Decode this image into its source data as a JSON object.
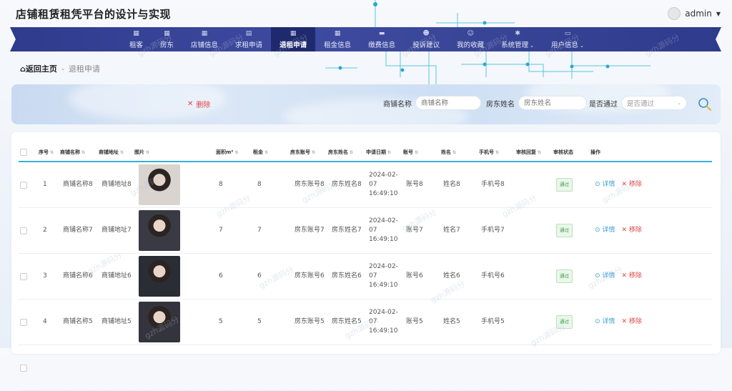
{
  "app": {
    "title": "店铺租赁租凭平台的设计与实现",
    "user": "admin"
  },
  "nav": {
    "items": [
      {
        "label": "租客",
        "icon": "grid-icon"
      },
      {
        "label": "房东",
        "icon": "grid-icon"
      },
      {
        "label": "店铺信息",
        "icon": "grid-icon"
      },
      {
        "label": "求租申请",
        "icon": "clipboard-icon"
      },
      {
        "label": "退租申请",
        "icon": "grid-icon",
        "active": true
      },
      {
        "label": "租金信息",
        "icon": "grid-icon"
      },
      {
        "label": "缴费信息",
        "icon": "chat-icon"
      },
      {
        "label": "投诉建议",
        "icon": "users-icon"
      },
      {
        "label": "我的收藏",
        "icon": "user-icon"
      },
      {
        "label": "系统管理",
        "icon": "settings-icon",
        "dropdown": true
      },
      {
        "label": "用户信息",
        "icon": "card-icon",
        "dropdown": true
      }
    ]
  },
  "breadcrumb": {
    "home": "返回主页",
    "separator": "-",
    "current": "退租申请"
  },
  "toolbar": {
    "delete_label": "删除"
  },
  "search": {
    "shop_name_label": "商铺名称",
    "shop_name_placeholder": "商铺名称",
    "landlord_name_label": "房东姓名",
    "landlord_name_placeholder": "房东姓名",
    "approved_label": "是否通过",
    "approved_placeholder": "是否通过"
  },
  "table": {
    "headers": [
      "序号",
      "商铺名称",
      "商铺地址",
      "图片",
      "面积m²",
      "租金",
      "房东账号",
      "房东姓名",
      "申请日期",
      "账号",
      "姓名",
      "手机号",
      "审核回复",
      "审核状态",
      "操作"
    ],
    "rows": [
      {
        "no": "1",
        "shop_name": "商铺名称8",
        "shop_addr": "商铺地址8",
        "area": "8",
        "rent": "8",
        "landlord_account": "房东账号8",
        "landlord_name": "房东姓名8",
        "date": "2024-02-07 16:49:10",
        "account": "账号8",
        "name": "姓名8",
        "phone": "手机号8",
        "reply": "",
        "status": "通过",
        "photo": "#d9d4cf"
      },
      {
        "no": "2",
        "shop_name": "商铺名称7",
        "shop_addr": "商铺地址7",
        "area": "7",
        "rent": "7",
        "landlord_account": "房东账号7",
        "landlord_name": "房东姓名7",
        "date": "2024-02-07 16:49:10",
        "account": "账号7",
        "name": "姓名7",
        "phone": "手机号7",
        "reply": "",
        "status": "通过",
        "photo": "#3a3a44"
      },
      {
        "no": "3",
        "shop_name": "商铺名称6",
        "shop_addr": "商铺地址6",
        "area": "6",
        "rent": "6",
        "landlord_account": "房东账号6",
        "landlord_name": "房东姓名6",
        "date": "2024-02-07 16:49:10",
        "account": "账号6",
        "name": "姓名6",
        "phone": "手机号6",
        "reply": "",
        "status": "通过",
        "photo": "#2b2d35"
      },
      {
        "no": "4",
        "shop_name": "商铺名称5",
        "shop_addr": "商铺地址5",
        "area": "5",
        "rent": "5",
        "landlord_account": "房东账号5",
        "landlord_name": "房东姓名5",
        "date": "2024-02-07 16:49:10",
        "account": "账号5",
        "name": "姓名5",
        "phone": "手机号5",
        "reply": "",
        "status": "通过",
        "photo": "#34343c"
      },
      {
        "no": "",
        "shop_name": "",
        "shop_addr": "",
        "area": "",
        "rent": "",
        "landlord_account": "",
        "landlord_name": "",
        "date": "",
        "account": "",
        "name": "",
        "phone": "",
        "reply": "",
        "status": "",
        "photo": "#ccc"
      }
    ],
    "actions": {
      "detail": "详情",
      "remove": "移除"
    }
  },
  "watermark": "gzh源码分"
}
